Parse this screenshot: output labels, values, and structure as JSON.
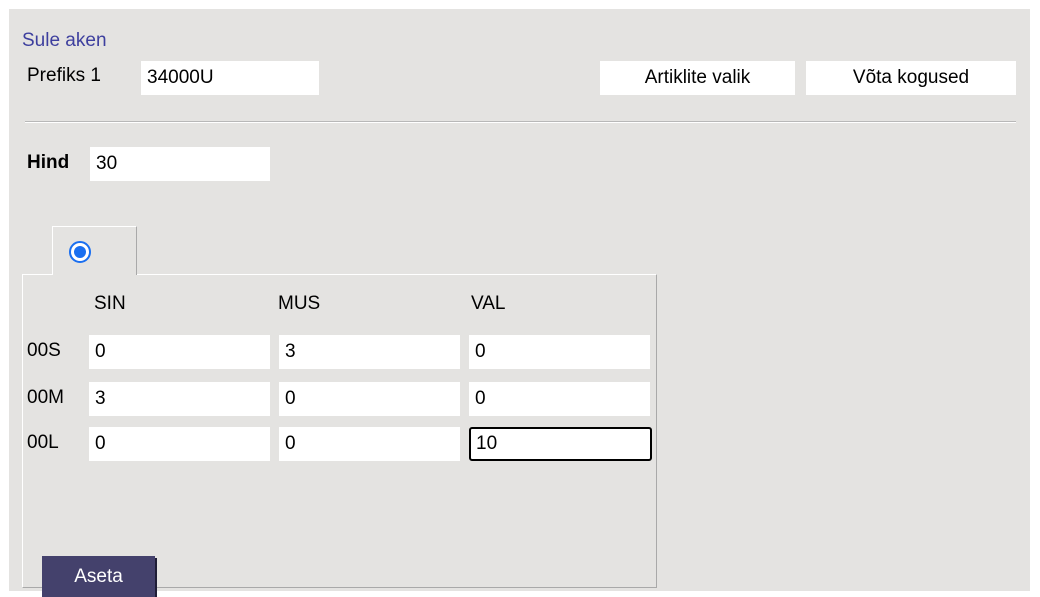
{
  "window": {
    "close_link": "Sule aken"
  },
  "prefix": {
    "label": "Prefiks 1",
    "value": "34000U"
  },
  "toolbar": {
    "select_items_label": "Artiklite valik",
    "take_quantities_label": "Võta kogused"
  },
  "price": {
    "label": "Hind",
    "value": "30"
  },
  "radio": {
    "selected": true
  },
  "matrix": {
    "columns": [
      "SIN",
      "MUS",
      "VAL"
    ],
    "rows": [
      {
        "label": "00S",
        "values": [
          "0",
          "3",
          "0"
        ]
      },
      {
        "label": "00M",
        "values": [
          "3",
          "0",
          "0"
        ]
      },
      {
        "label": "00L",
        "values": [
          "0",
          "0",
          "10"
        ]
      }
    ]
  },
  "apply_button_label": "Aseta",
  "colors": {
    "panel_bg": "#e4e3e1",
    "link": "#3d3f9e",
    "apply_button_bg": "#44416c",
    "radio_accent": "#1a6ff0"
  }
}
